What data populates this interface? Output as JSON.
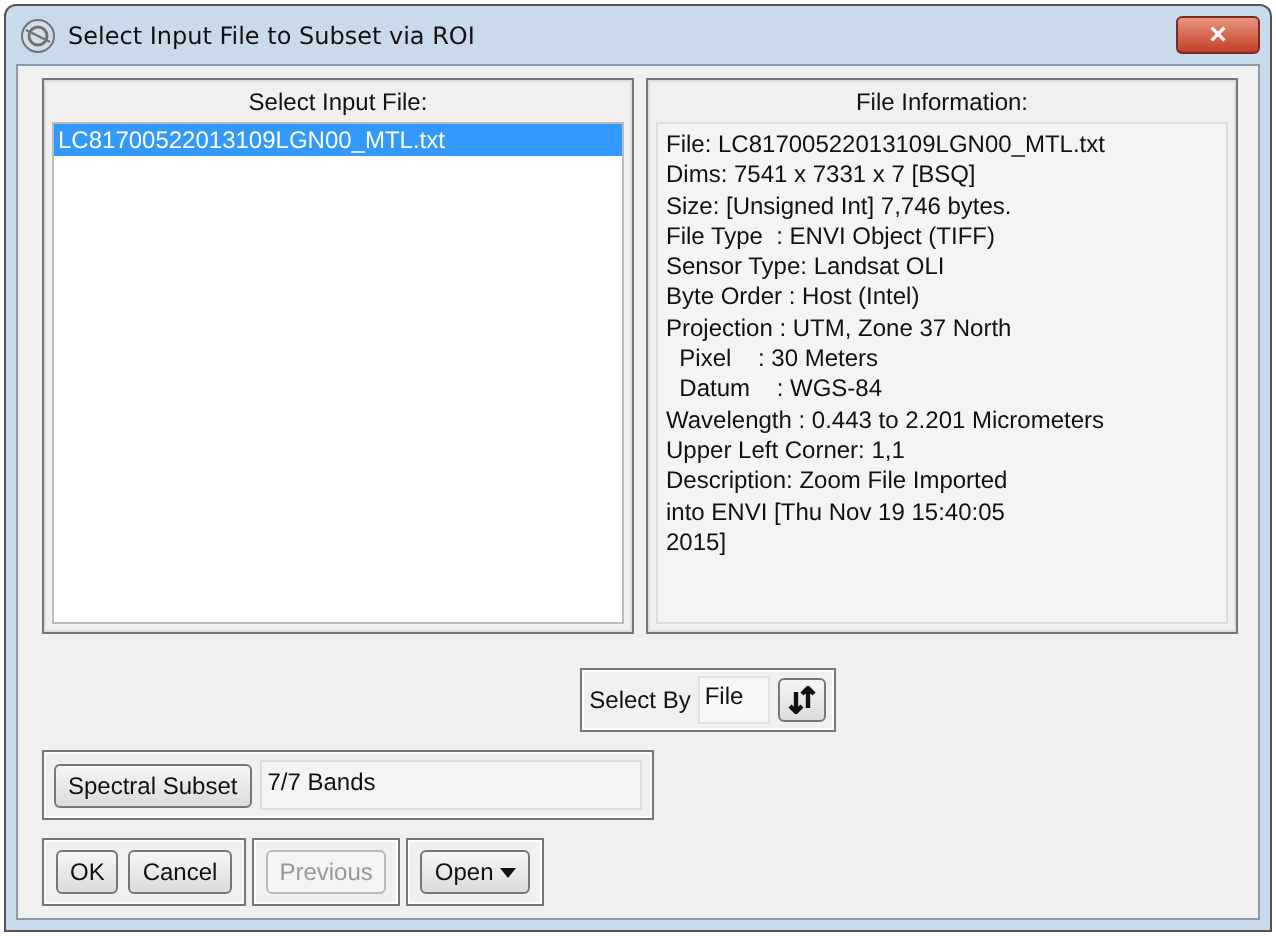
{
  "window": {
    "title": "Select Input File to Subset via ROI",
    "close": "×"
  },
  "input_files": {
    "heading": "Select Input File:",
    "items": [
      {
        "label": "LC81700522013109LGN00_MTL.txt",
        "selected": true
      }
    ]
  },
  "file_information": {
    "heading": "File Information:",
    "lines": [
      "File: LC81700522013109LGN00_MTL.txt",
      "Dims: 7541 x 7331 x 7 [BSQ]",
      "Size: [Unsigned Int] 7,746 bytes.",
      "File Type  : ENVI Object (TIFF)",
      "Sensor Type: Landsat OLI",
      "Byte Order : Host (Intel)",
      "Projection : UTM, Zone 37 North",
      "  Pixel    : 30 Meters",
      "  Datum    : WGS-84",
      "Wavelength : 0.443 to 2.201 Micrometers",
      "Upper Left Corner: 1,1",
      "Description: Zoom File Imported",
      "into ENVI [Thu Nov 19 15:40:05",
      "2015]"
    ]
  },
  "select_by": {
    "label": "Select By",
    "value": "File"
  },
  "spectral_subset": {
    "button": "Spectral Subset",
    "value": "7/7 Bands"
  },
  "button_groups": [
    [
      {
        "label": "OK",
        "disabled": false,
        "kind": "push"
      },
      {
        "label": "Cancel",
        "disabled": false,
        "kind": "push"
      }
    ],
    [
      {
        "label": "Previous",
        "disabled": true,
        "kind": "push"
      }
    ],
    [
      {
        "label": "Open",
        "disabled": false,
        "kind": "menu"
      }
    ]
  ]
}
